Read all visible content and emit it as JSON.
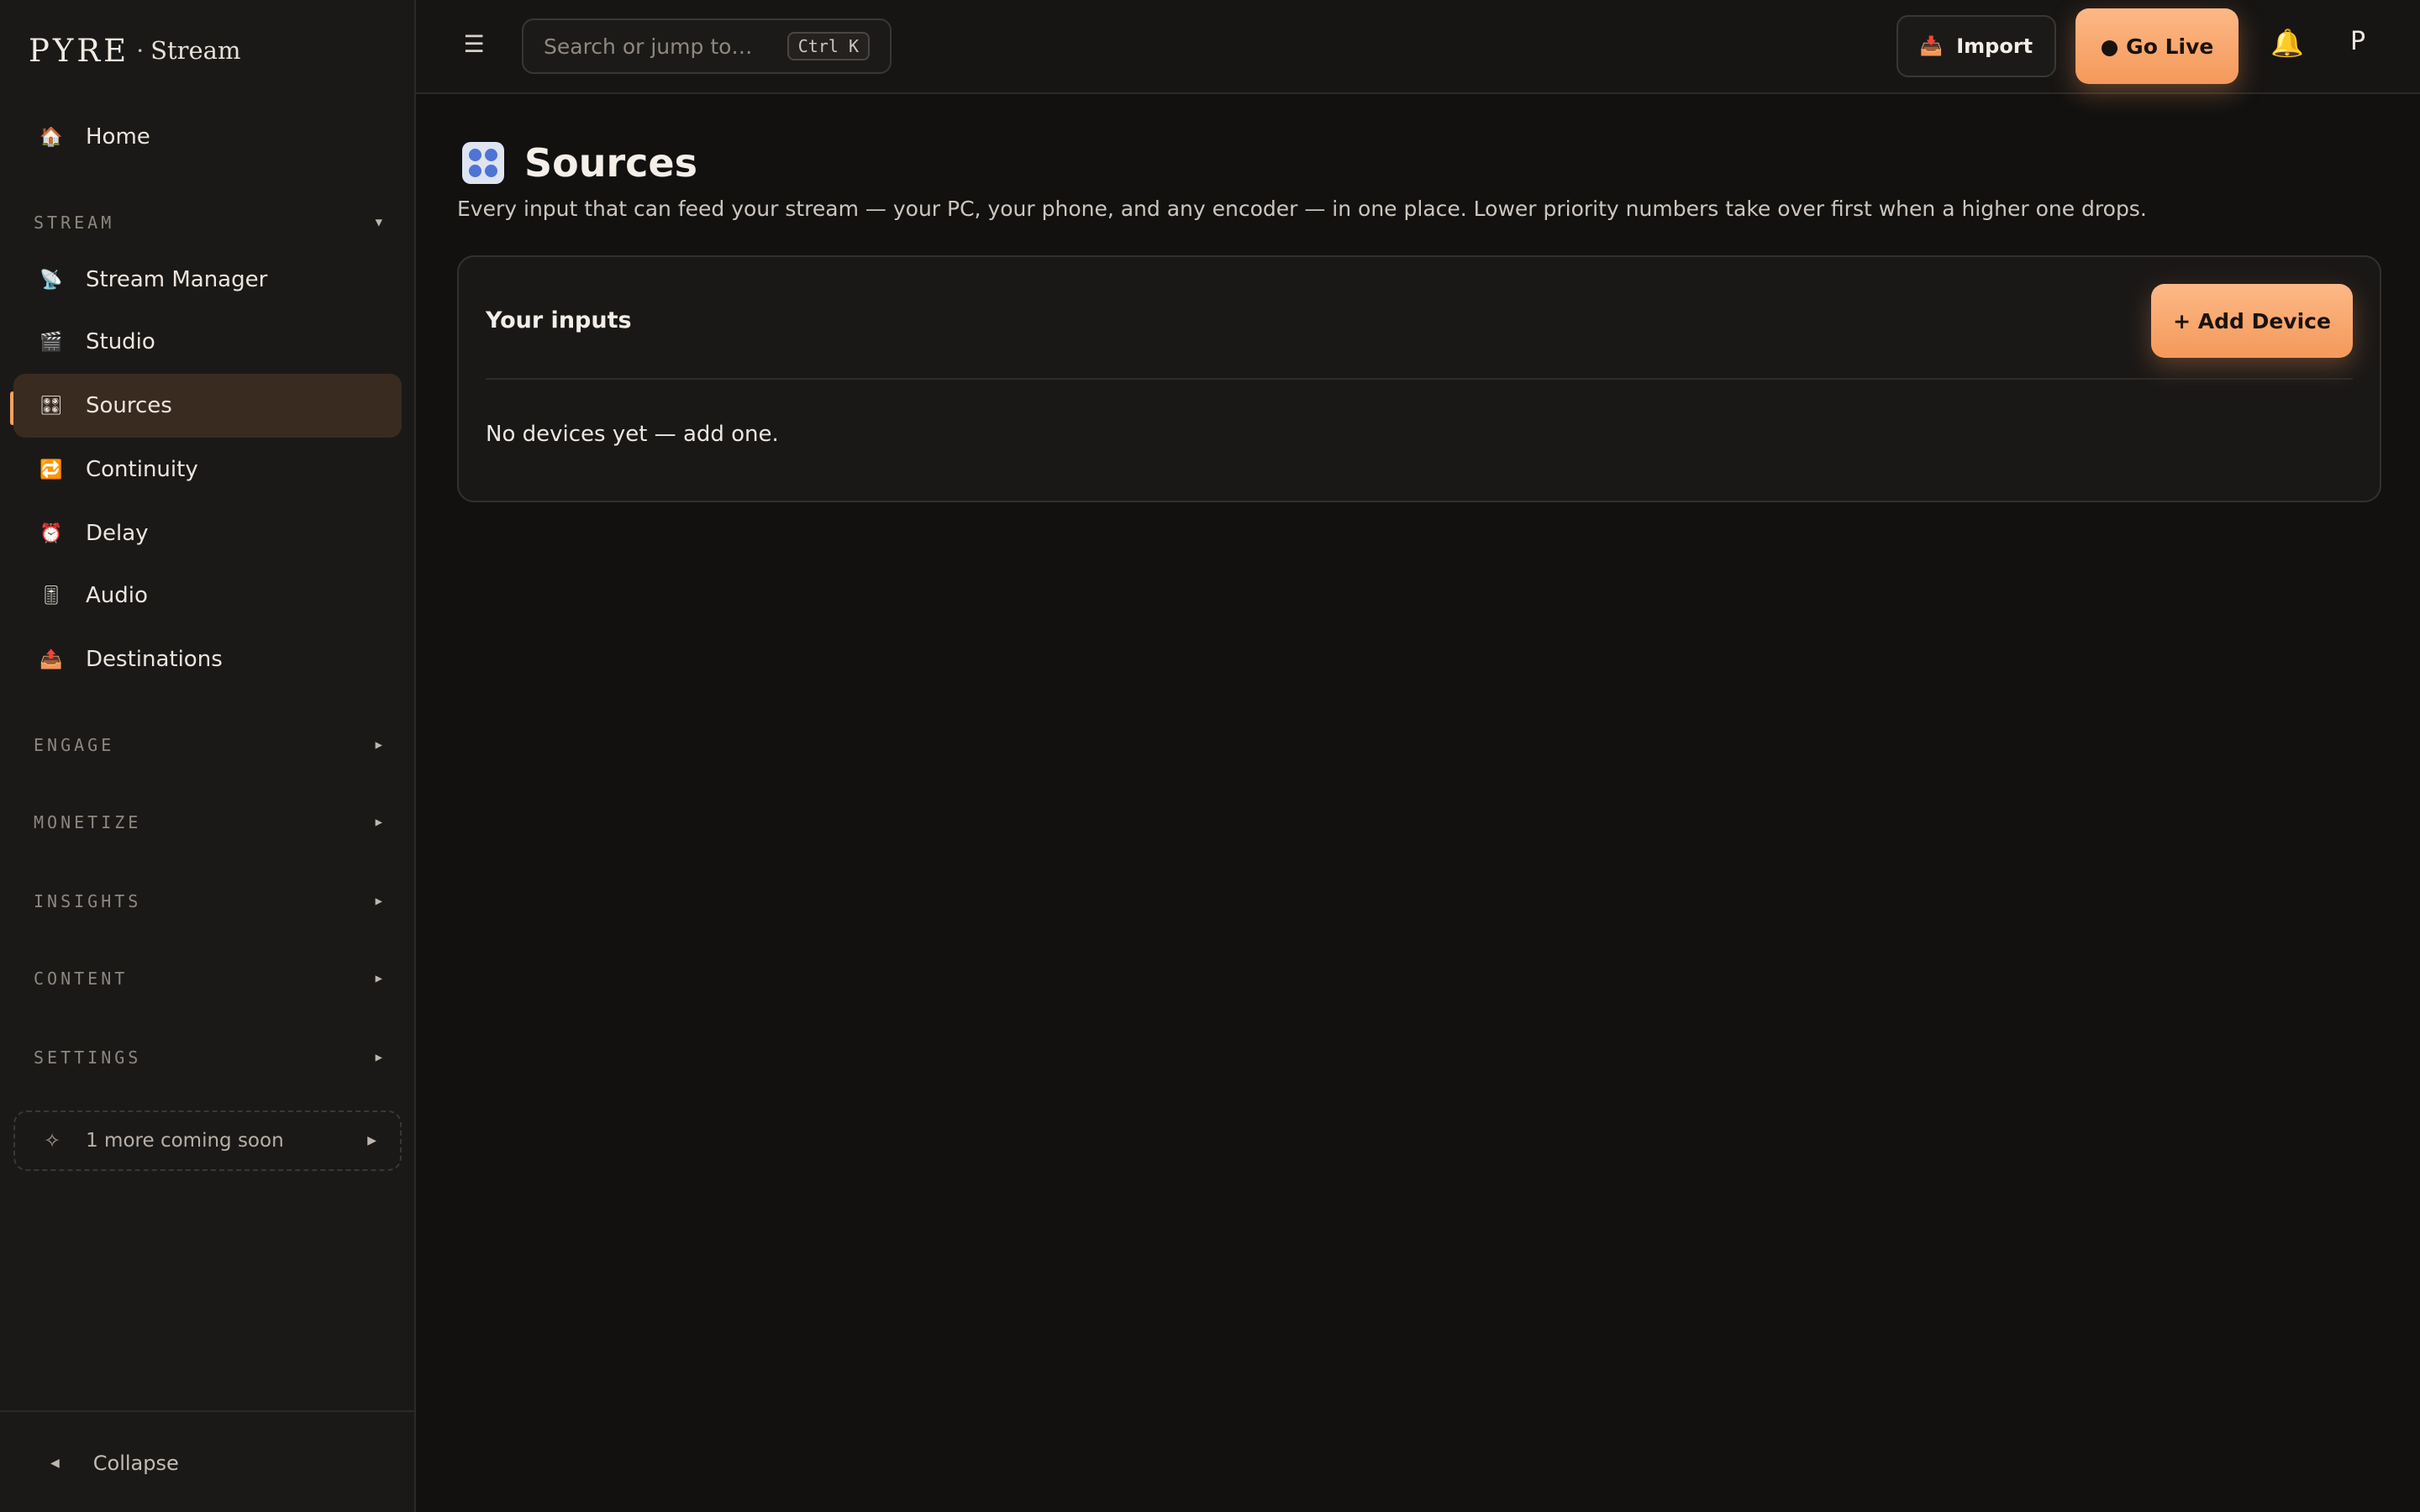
{
  "brand": {
    "mark": "PYRE",
    "separator": "·",
    "product": "Stream"
  },
  "sidebar": {
    "home": {
      "label": "Home",
      "icon": "house-icon"
    },
    "stream_section": {
      "label": "STREAM"
    },
    "stream_items": [
      {
        "label": "Stream Manager",
        "icon": "satellite-icon"
      },
      {
        "label": "Studio",
        "icon": "clapper-icon"
      },
      {
        "label": "Sources",
        "icon": "control-knobs-icon",
        "active": true
      },
      {
        "label": "Continuity",
        "icon": "repeat-icon"
      },
      {
        "label": "Delay",
        "icon": "alarm-clock-icon"
      },
      {
        "label": "Audio",
        "icon": "level-slider-icon"
      },
      {
        "label": "Destinations",
        "icon": "outbox-icon"
      }
    ],
    "sections": [
      {
        "label": "ENGAGE"
      },
      {
        "label": "MONETIZE"
      },
      {
        "label": "INSIGHTS"
      },
      {
        "label": "CONTENT"
      },
      {
        "label": "SETTINGS"
      }
    ],
    "coming_soon": "1 more coming soon",
    "collapse_label": "Collapse"
  },
  "topbar": {
    "search_placeholder": "Search or jump to…",
    "shortcut": "Ctrl K",
    "import_label": "Import",
    "go_live_label": "● Go Live",
    "avatar_initial": "P"
  },
  "page": {
    "title": "Sources",
    "description": "Every input that can feed your stream — your PC, your phone, and any encoder — in one place. Lower priority numbers take over first when a higher one drops.",
    "card": {
      "title": "Your inputs",
      "add_button": "+ Add Device",
      "empty_text": "No devices yet — add one."
    }
  },
  "colors": {
    "accent": "#f4a361",
    "background": "#121110",
    "sidebar": "#1b1917",
    "active_item": "#3a2b20"
  }
}
